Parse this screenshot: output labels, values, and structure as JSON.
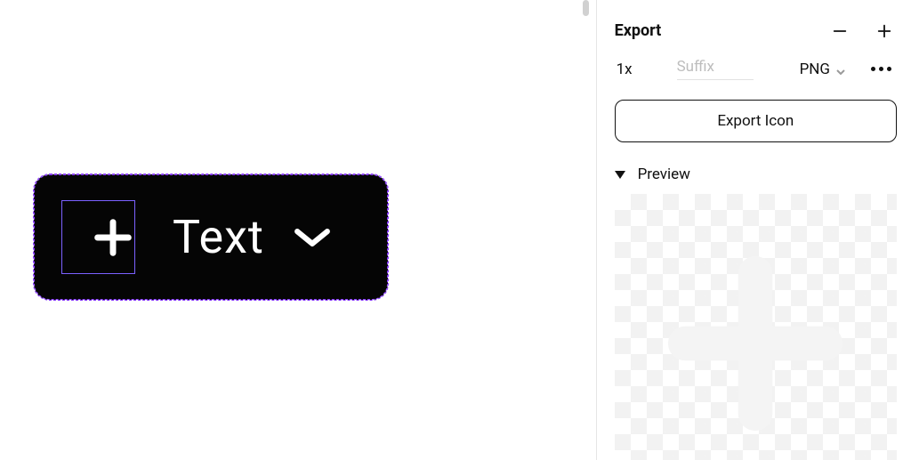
{
  "panel": {
    "title": "Export",
    "scale": "1x",
    "suffix_placeholder": "Suffix",
    "suffix_value": "",
    "format": "PNG",
    "export_button_label": "Export Icon",
    "preview_label": "Preview"
  },
  "canvas": {
    "component_label": "Text"
  },
  "colors": {
    "selection": "#7b61ff",
    "component_fill": "#050505"
  }
}
